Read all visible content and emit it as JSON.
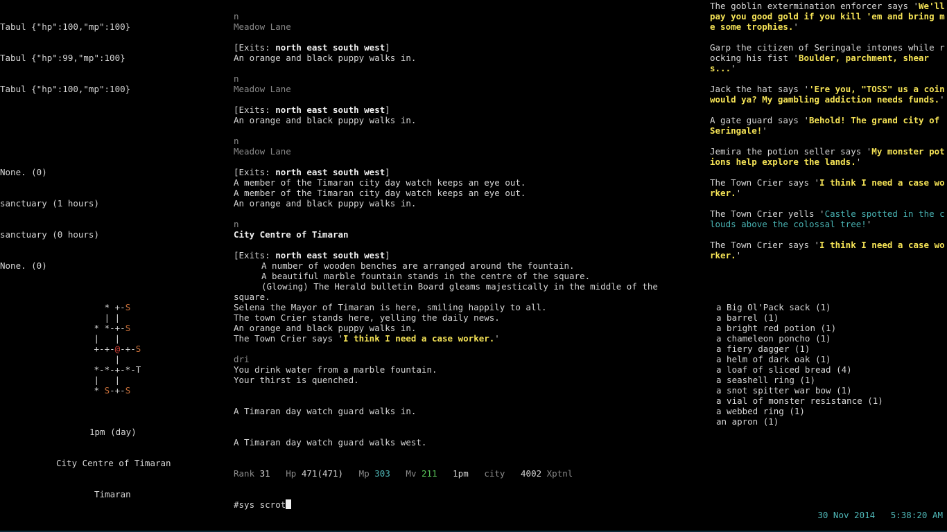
{
  "left": {
    "vitals": [
      "Tabul {\"hp\":100,\"mp\":100}",
      "Tabul {\"hp\":99,\"mp\":100}",
      "Tabul {\"hp\":100,\"mp\":100}"
    ],
    "affects": [
      "None. (0)",
      "sanctuary (1 hours)",
      "sanctuary (0 hours)",
      "None. (0)"
    ],
    "map": [
      [
        "   ",
        "*",
        " +-",
        "S"
      ],
      [
        "   | |",
        "",
        "",
        ""
      ],
      [
        " ",
        "*",
        " *-+-",
        "S"
      ],
      [
        " |   |",
        "",
        "",
        ""
      ],
      [
        " +-+-",
        "@",
        "-+-",
        "S"
      ],
      [
        "     |",
        "",
        "",
        ""
      ],
      [
        " *-*-+-*-T",
        "",
        "",
        ""
      ],
      [
        " |   |",
        "",
        "",
        ""
      ],
      [
        " * ",
        "S",
        "-+-",
        "S"
      ]
    ],
    "time": "1pm (day)",
    "room": "City Centre of Timaran",
    "area": "Timaran"
  },
  "main": {
    "blocks": [
      {
        "cmd": "n",
        "room": "Meadow Lane",
        "room_bold": false,
        "exits_prefix": "[Exits: ",
        "exits": "north east south west",
        "exits_suffix": "]",
        "desc": [],
        "events": [
          "An orange and black puppy walks in."
        ]
      },
      {
        "cmd": "n",
        "room": "Meadow Lane",
        "room_bold": false,
        "exits_prefix": "[Exits: ",
        "exits": "north east south west",
        "exits_suffix": "]",
        "desc": [],
        "events": [
          "An orange and black puppy walks in."
        ]
      },
      {
        "cmd": "n",
        "room": "Meadow Lane",
        "room_bold": false,
        "exits_prefix": "[Exits: ",
        "exits": "north east south west",
        "exits_suffix": "]",
        "desc": [],
        "events": [
          "A member of the Timaran city day watch keeps an eye out.",
          "A member of the Timaran city day watch keeps an eye out.",
          "An orange and black puppy walks in."
        ]
      }
    ],
    "centre": {
      "cmd": "n",
      "room": "City Centre of Timaran",
      "exits_prefix": "[Exits: ",
      "exits": "north east south west",
      "exits_suffix": "]",
      "desc": [
        "A number of wooden benches are arranged around the fountain.",
        "A beautiful marble fountain stands in the centre of the square.",
        "(Glowing) The Herald bulletin Board gleams majestically in the middle of the"
      ],
      "desc_wrap": "square.",
      "events": [
        "Selena the Mayor of Timaran is here, smiling happily to all.",
        "The town Crier stands here, yelling the daily news.",
        "An orange and black puppy walks in."
      ],
      "crier_prefix": "The Town Crier says '",
      "crier_speech": "I think I need a case worker.",
      "crier_suffix": "'"
    },
    "drink": {
      "cmd": "dri",
      "lines": [
        "You drink water from a marble fountain.",
        "Your thirst is quenched."
      ]
    },
    "guard_in": "A Timaran day watch guard walks in.",
    "guard_west": "A Timaran day watch guard walks west."
  },
  "status": {
    "rank_label": "Rank",
    "rank": "31",
    "hp_label": "Hp",
    "hp": "471(471)",
    "mp_label": "Mp",
    "mp": "303",
    "mv_label": "Mv",
    "mv": "211",
    "time": "1pm",
    "city_label": "city",
    "xp": "4002",
    "xp_label": "Xptnl"
  },
  "command": {
    "input": "#sys scrot"
  },
  "chat": [
    {
      "prefix": "The goblin extermination enforcer says '",
      "speech": "We'll pay you good gold if you kill 'em and bring me some trophies.",
      "suffix": "'",
      "style": "say"
    },
    {
      "prefix": "Garp the citizen of Seringale intones while rocking his fist '",
      "speech": "Boulder, parchment, shears...",
      "suffix": "'",
      "style": "say"
    },
    {
      "prefix": "Jack the hat says '",
      "speech": "'Ere you, \"TOSS\" us a coin would ya?  My gambling addiction needs funds.",
      "suffix": "'",
      "style": "say"
    },
    {
      "prefix": "A gate guard says '",
      "speech": "Behold! The grand city of Seringale!",
      "suffix": "'",
      "style": "say"
    },
    {
      "prefix": "Jemira the potion seller says '",
      "speech": "My monster potions help explore the lands.",
      "suffix": "'",
      "style": "say"
    },
    {
      "prefix": "The Town Crier says '",
      "speech": "I think I need a case worker.",
      "suffix": "'",
      "style": "say"
    },
    {
      "prefix": "The Town Crier yells '",
      "speech": "Castle spotted in the clouds above the colossal tree!",
      "suffix": "'",
      "style": "yell"
    },
    {
      "prefix": "The Town Crier says '",
      "speech": "I think I need a case worker.",
      "suffix": "'",
      "style": "say"
    }
  ],
  "inventory": [
    "a Big Ol'Pack sack (1)",
    "a barrel (1)",
    "a bright red potion (1)",
    "a chameleon poncho (1)",
    "a fiery dagger (1)",
    "a helm of dark oak (1)",
    "a loaf of sliced bread (4)",
    "a seashell ring (1)",
    "a snot spitter war bow (1)",
    "a vial of monster resistance (1)",
    "a webbed ring (1)",
    "an apron (1)"
  ],
  "clock": {
    "date": "30 Nov 2014",
    "time": "5:38:20 AM"
  },
  "colors": {
    "background": "#000000",
    "text": "#d6d6d6",
    "speech": "#f5e356",
    "yell": "#49b3b3",
    "map_exit": "#c8703a",
    "map_self": "#e0443a",
    "mv": "#5ac85a",
    "mp": "#4fb7b7"
  }
}
